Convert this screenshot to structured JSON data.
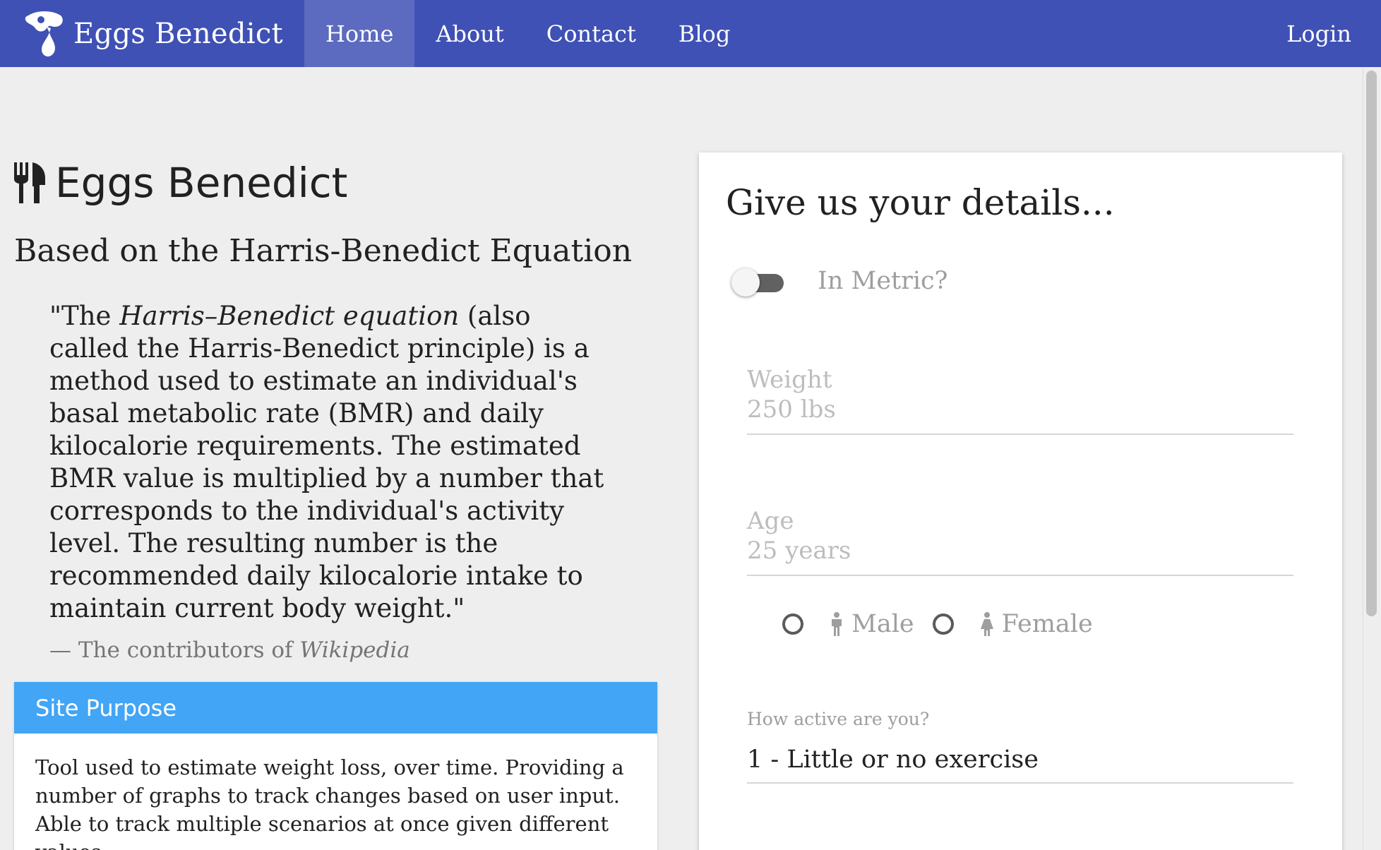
{
  "navbar": {
    "brand": "Eggs Benedict",
    "items": [
      {
        "label": "Home",
        "active": true
      },
      {
        "label": "About",
        "active": false
      },
      {
        "label": "Contact",
        "active": false
      },
      {
        "label": "Blog",
        "active": false
      }
    ],
    "login": "Login",
    "color": "#3f51b5",
    "active_color": "#5c6bc0"
  },
  "hero": {
    "title": "Eggs Benedict",
    "title_icon": "cutlery-icon",
    "subtitle": "Based on the Harris-Benedict Equation"
  },
  "quote": {
    "open": "\"The ",
    "term": "Harris–Benedict equation",
    "text": " (also called the Harris-Benedict principle) is a method used to estimate an individual's basal metabolic rate (BMR) and daily kilocalorie requirements. The estimated BMR value is multiplied by a number that corresponds to the individual's activity level. The resulting number is the recommended daily kilocalorie intake to maintain current body weight.\"",
    "source_prefix": "— The contributors of ",
    "source_name": "Wikipedia"
  },
  "site_purpose": {
    "header": "Site Purpose",
    "body": "Tool used to estimate weight loss, over time. Providing a number of graphs to track changes based on user input. Able to track multiple scenarios at once given different values.",
    "header_color": "#42a5f5"
  },
  "form": {
    "title": "Give us your details...",
    "metric_toggle_label": "In Metric?",
    "metric_on": false,
    "weight_label": "Weight",
    "weight_placeholder": "250 lbs",
    "age_label": "Age",
    "age_placeholder": "25 years",
    "gender_options": [
      "Male",
      "Female"
    ],
    "activity_label": "How active are you?",
    "activity_value": "1 - Little or no exercise"
  }
}
